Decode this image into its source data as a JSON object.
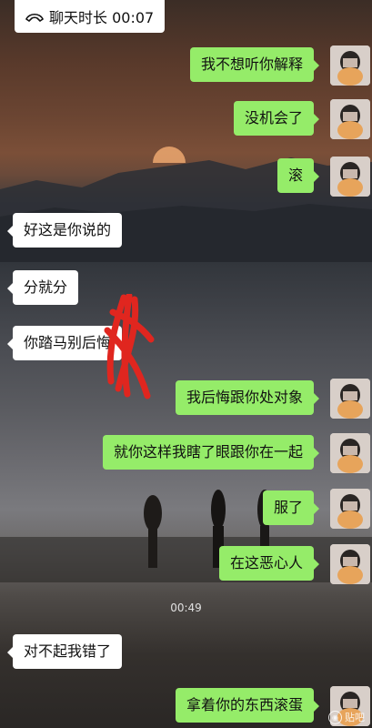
{
  "call": {
    "label": "聊天时长 00:07"
  },
  "messages_block1": [
    {
      "side": "right",
      "text": "我不想听你解释"
    },
    {
      "side": "right",
      "text": "没机会了"
    },
    {
      "side": "right",
      "text": "滚"
    },
    {
      "side": "left",
      "text": "好这是你说的"
    },
    {
      "side": "left",
      "text": "分就分"
    },
    {
      "side": "left",
      "text": "你踏马别后悔"
    },
    {
      "side": "right",
      "text": "我后悔跟你处对象"
    },
    {
      "side": "right",
      "text": "就你这样我瞎了眼跟你在一起"
    },
    {
      "side": "right",
      "text": "服了"
    },
    {
      "side": "right",
      "text": "在这恶心人"
    }
  ],
  "timestamp": "00:49",
  "messages_block2": [
    {
      "side": "left",
      "text": "对不起我错了"
    },
    {
      "side": "right",
      "text": "拿着你的东西滚蛋"
    }
  ],
  "watermark": {
    "text": "贴吧",
    "icon": "weibo-icon"
  },
  "colors": {
    "bubble_right": "#95ec69",
    "bubble_left": "#ffffff",
    "scribble": "#e0261f"
  }
}
